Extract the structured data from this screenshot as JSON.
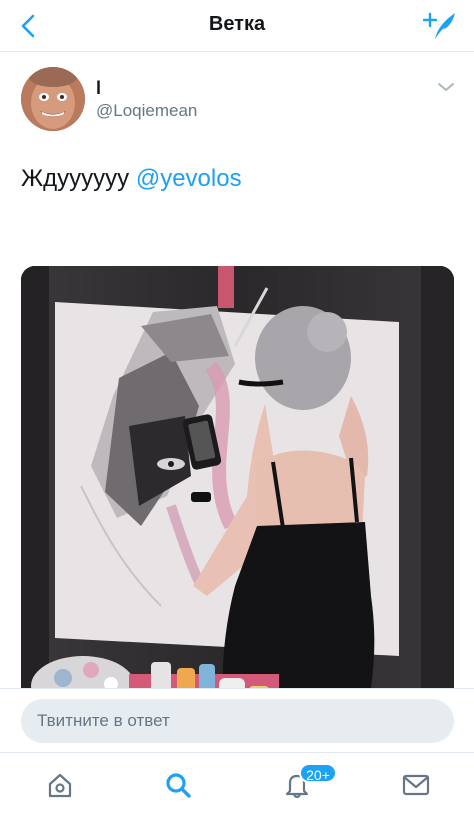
{
  "header": {
    "title": "Ветка",
    "back_icon": "chevron-left-icon",
    "compose_icon": "compose-tweet-icon"
  },
  "tweet": {
    "display_name": "l",
    "handle": "@Loqiemean",
    "text_prefix": "Ждуууууу ",
    "mention": "@yevolos"
  },
  "reply": {
    "placeholder": "Твитните в ответ"
  },
  "tabbar": {
    "items": [
      "home-icon",
      "search-icon",
      "notifications-icon",
      "messages-icon"
    ],
    "active": "search-icon",
    "notifications_badge": "20+"
  },
  "colors": {
    "accent": "#1da1f2",
    "text": "#14171a",
    "secondary_text": "#657786",
    "divider": "#e1e8ed",
    "input_bg": "#e6ecf0"
  }
}
